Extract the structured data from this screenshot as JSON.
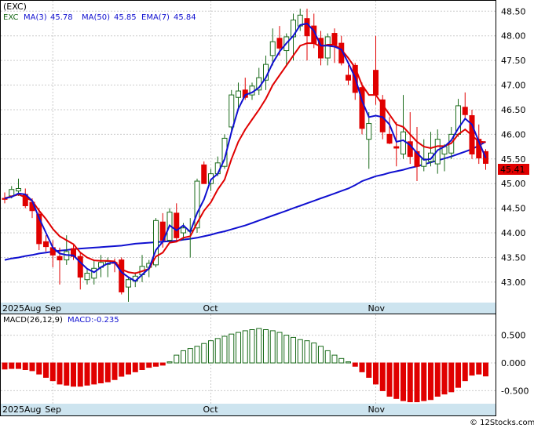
{
  "colors": {
    "up_candle": "#1a6b1a",
    "down_candle": "#e00000",
    "ema_line": "#e00000",
    "ma_line": "#1010d0",
    "macd_positive": "#1a6b1a",
    "macd_negative": "#e00000",
    "date_band": "#cde4ef",
    "price_tag_bg": "#e00000"
  },
  "header": {
    "symbol": "(EXC)",
    "ticker": "EXC",
    "ma3_label": "MA(3)",
    "ma3_value": "45.78",
    "ma50_label": "MA(50)",
    "ma50_value": "45.85",
    "ema7_label": "EMA(7)",
    "ema7_value": "45.84"
  },
  "last_price_tag": "45.41",
  "macd_header": {
    "label": "MACD(26,12,9)",
    "value_label": "MACD:-0.235"
  },
  "date_labels": [
    "2025Aug",
    "Sep",
    "Oct",
    "Nov"
  ],
  "watermark": "© 12Stocks.com",
  "chart_data": [
    {
      "type": "candlestick",
      "y_ticks": [
        "43.00",
        "43.50",
        "44.00",
        "44.50",
        "45.00",
        "45.50",
        "46.00",
        "46.50",
        "47.00",
        "47.50",
        "48.00",
        "48.50"
      ],
      "ylim": [
        42.6,
        48.6
      ],
      "x_tick_labels": [
        {
          "label": "2025Aug",
          "index": 0
        },
        {
          "label": "Sep",
          "index": 7
        },
        {
          "label": "Oct",
          "index": 30
        },
        {
          "label": "Nov",
          "index": 54
        }
      ],
      "candles": [
        [
          44.7,
          44.82,
          44.6,
          44.68
        ],
        [
          44.75,
          44.95,
          44.7,
          44.88
        ],
        [
          44.85,
          45.1,
          44.75,
          44.9
        ],
        [
          44.78,
          44.9,
          44.5,
          44.55
        ],
        [
          44.62,
          44.7,
          44.3,
          44.45
        ],
        [
          44.38,
          44.5,
          43.65,
          43.78
        ],
        [
          43.82,
          43.95,
          43.62,
          43.72
        ],
        [
          43.7,
          43.85,
          43.3,
          43.55
        ],
        [
          43.52,
          43.7,
          42.95,
          43.45
        ],
        [
          43.45,
          43.95,
          43.35,
          43.62
        ],
        [
          43.68,
          43.75,
          43.45,
          43.52
        ],
        [
          43.52,
          43.6,
          42.85,
          43.1
        ],
        [
          43.05,
          43.25,
          42.95,
          43.18
        ],
        [
          43.08,
          43.45,
          42.95,
          43.28
        ],
        [
          43.3,
          43.55,
          43.1,
          43.4
        ],
        [
          43.36,
          43.5,
          43.1,
          43.42
        ],
        [
          43.4,
          43.48,
          43.2,
          43.38
        ],
        [
          43.45,
          43.5,
          42.75,
          42.8
        ],
        [
          42.9,
          43.1,
          42.6,
          43.05
        ],
        [
          43.02,
          43.2,
          42.9,
          43.12
        ],
        [
          43.15,
          43.55,
          43.0,
          43.32
        ],
        [
          43.3,
          43.45,
          43.1,
          43.38
        ],
        [
          43.35,
          44.3,
          43.3,
          44.25
        ],
        [
          44.22,
          44.4,
          43.7,
          43.85
        ],
        [
          43.85,
          44.5,
          43.8,
          44.42
        ],
        [
          44.4,
          44.6,
          43.82,
          43.9
        ],
        [
          44.0,
          44.2,
          43.85,
          44.1
        ],
        [
          44.05,
          44.3,
          43.5,
          44.05
        ],
        [
          44.1,
          45.1,
          44.0,
          45.05
        ],
        [
          45.38,
          45.45,
          45.0,
          45.0
        ],
        [
          45.0,
          45.3,
          44.85,
          45.2
        ],
        [
          45.2,
          45.55,
          45.15,
          45.42
        ],
        [
          45.35,
          46.0,
          45.3,
          45.92
        ],
        [
          46.15,
          46.9,
          46.05,
          46.8
        ],
        [
          46.75,
          47.05,
          46.5,
          46.88
        ],
        [
          46.9,
          47.15,
          46.7,
          46.75
        ],
        [
          46.8,
          47.05,
          46.7,
          46.98
        ],
        [
          46.9,
          47.35,
          46.8,
          47.15
        ],
        [
          47.1,
          47.6,
          46.9,
          47.42
        ],
        [
          47.6,
          48.15,
          47.4,
          47.88
        ],
        [
          47.95,
          48.2,
          47.6,
          47.75
        ],
        [
          47.7,
          48.05,
          47.4,
          47.98
        ],
        [
          47.98,
          48.45,
          47.5,
          48.32
        ],
        [
          48.2,
          48.55,
          48.1,
          48.42
        ],
        [
          48.35,
          48.55,
          47.5,
          48.0
        ],
        [
          48.2,
          48.45,
          47.75,
          47.85
        ],
        [
          47.95,
          48.1,
          47.4,
          47.55
        ],
        [
          47.55,
          48.05,
          47.4,
          47.98
        ],
        [
          48.05,
          48.15,
          47.45,
          47.82
        ],
        [
          47.85,
          48.0,
          47.4,
          47.45
        ],
        [
          47.2,
          47.4,
          47.0,
          47.1
        ],
        [
          47.4,
          47.45,
          46.7,
          46.85
        ],
        [
          46.95,
          47.05,
          46.0,
          46.12
        ],
        [
          45.9,
          46.45,
          45.3,
          46.22
        ],
        [
          47.3,
          48.0,
          46.6,
          46.8
        ],
        [
          46.7,
          46.8,
          45.9,
          46.05
        ],
        [
          46.0,
          46.35,
          45.8,
          45.82
        ],
        [
          45.75,
          46.25,
          45.35,
          45.72
        ],
        [
          45.6,
          46.8,
          45.5,
          46.05
        ],
        [
          45.85,
          46.45,
          45.4,
          45.55
        ],
        [
          45.65,
          46.15,
          45.05,
          45.35
        ],
        [
          45.35,
          45.9,
          45.25,
          45.5
        ],
        [
          45.45,
          46.05,
          45.35,
          45.62
        ],
        [
          45.4,
          46.1,
          45.2,
          45.9
        ],
        [
          45.6,
          45.8,
          45.25,
          45.75
        ],
        [
          45.62,
          46.15,
          45.5,
          46.0
        ],
        [
          46.0,
          46.72,
          45.95,
          46.58
        ],
        [
          46.55,
          46.85,
          46.3,
          46.4
        ],
        [
          46.38,
          46.5,
          45.5,
          45.6
        ],
        [
          45.9,
          46.2,
          45.4,
          45.52
        ],
        [
          45.65,
          45.7,
          45.28,
          45.41
        ]
      ],
      "ma3": [
        44.7,
        44.73,
        44.8,
        44.78,
        44.65,
        44.3,
        44.0,
        43.7,
        43.58,
        43.55,
        43.54,
        43.4,
        43.27,
        43.2,
        43.3,
        43.38,
        43.4,
        43.2,
        43.1,
        43.02,
        43.15,
        43.28,
        43.65,
        43.82,
        44.15,
        44.05,
        44.15,
        44.02,
        44.4,
        44.68,
        45.08,
        45.2,
        45.5,
        46.05,
        46.52,
        46.8,
        46.85,
        46.95,
        47.15,
        47.45,
        47.68,
        47.85,
        48.0,
        48.22,
        48.25,
        48.1,
        47.8,
        47.8,
        47.78,
        47.72,
        47.45,
        47.15,
        46.68,
        46.35,
        46.38,
        46.35,
        46.2,
        45.85,
        45.88,
        45.78,
        45.62,
        45.48,
        45.5,
        45.68,
        45.75,
        45.88,
        46.12,
        46.32,
        46.2,
        45.85,
        45.52
      ],
      "ma50": [
        43.45,
        43.48,
        43.5,
        43.53,
        43.55,
        43.58,
        43.6,
        43.62,
        43.64,
        43.65,
        43.67,
        43.68,
        43.69,
        43.7,
        43.71,
        43.72,
        43.73,
        43.74,
        43.76,
        43.78,
        43.79,
        43.8,
        43.81,
        43.82,
        43.83,
        43.84,
        43.86,
        43.88,
        43.9,
        43.93,
        43.96,
        44.0,
        44.03,
        44.07,
        44.11,
        44.15,
        44.2,
        44.25,
        44.3,
        44.35,
        44.4,
        44.45,
        44.5,
        44.55,
        44.6,
        44.65,
        44.7,
        44.75,
        44.8,
        44.85,
        44.9,
        44.97,
        45.05,
        45.1,
        45.15,
        45.18,
        45.22,
        45.25,
        45.28,
        45.32,
        45.35,
        45.39,
        45.43,
        45.47,
        45.51,
        45.55,
        45.6,
        45.65,
        45.7,
        45.77,
        45.85
      ],
      "ema7": [
        44.7,
        44.74,
        44.78,
        44.72,
        44.65,
        44.45,
        44.28,
        44.08,
        43.93,
        43.85,
        43.77,
        43.6,
        43.5,
        43.44,
        43.43,
        43.43,
        43.42,
        43.26,
        43.2,
        43.18,
        43.22,
        43.27,
        43.52,
        43.6,
        43.8,
        43.82,
        43.9,
        43.93,
        44.2,
        44.45,
        44.62,
        44.88,
        45.08,
        45.5,
        45.85,
        46.1,
        46.3,
        46.5,
        46.72,
        47.0,
        47.2,
        47.4,
        47.6,
        47.8,
        47.85,
        47.85,
        47.78,
        47.82,
        47.82,
        47.72,
        47.55,
        47.35,
        47.0,
        46.8,
        46.8,
        46.6,
        46.4,
        46.2,
        46.15,
        46.0,
        45.85,
        45.75,
        45.72,
        45.76,
        45.76,
        45.82,
        46.0,
        46.1,
        45.98,
        45.85,
        45.84
      ]
    },
    {
      "type": "bar",
      "name_label": "MACD(26,12,9)",
      "y_ticks": [
        "-0.500",
        "0.000",
        "0.500"
      ],
      "ylim": [
        -0.72,
        0.72
      ],
      "values": [
        -0.11,
        -0.1,
        -0.1,
        -0.12,
        -0.14,
        -0.2,
        -0.26,
        -0.32,
        -0.38,
        -0.4,
        -0.42,
        -0.42,
        -0.4,
        -0.38,
        -0.36,
        -0.34,
        -0.3,
        -0.24,
        -0.2,
        -0.16,
        -0.12,
        -0.08,
        -0.06,
        -0.04,
        0.02,
        0.14,
        0.22,
        0.26,
        0.3,
        0.35,
        0.4,
        0.44,
        0.48,
        0.52,
        0.55,
        0.58,
        0.6,
        0.62,
        0.6,
        0.58,
        0.55,
        0.5,
        0.46,
        0.42,
        0.4,
        0.36,
        0.3,
        0.22,
        0.14,
        0.08,
        0.02,
        -0.06,
        -0.16,
        -0.26,
        -0.38,
        -0.5,
        -0.6,
        -0.64,
        -0.68,
        -0.7,
        -0.7,
        -0.68,
        -0.66,
        -0.6,
        -0.56,
        -0.52,
        -0.44,
        -0.32,
        -0.22,
        -0.2,
        -0.235
      ]
    }
  ]
}
